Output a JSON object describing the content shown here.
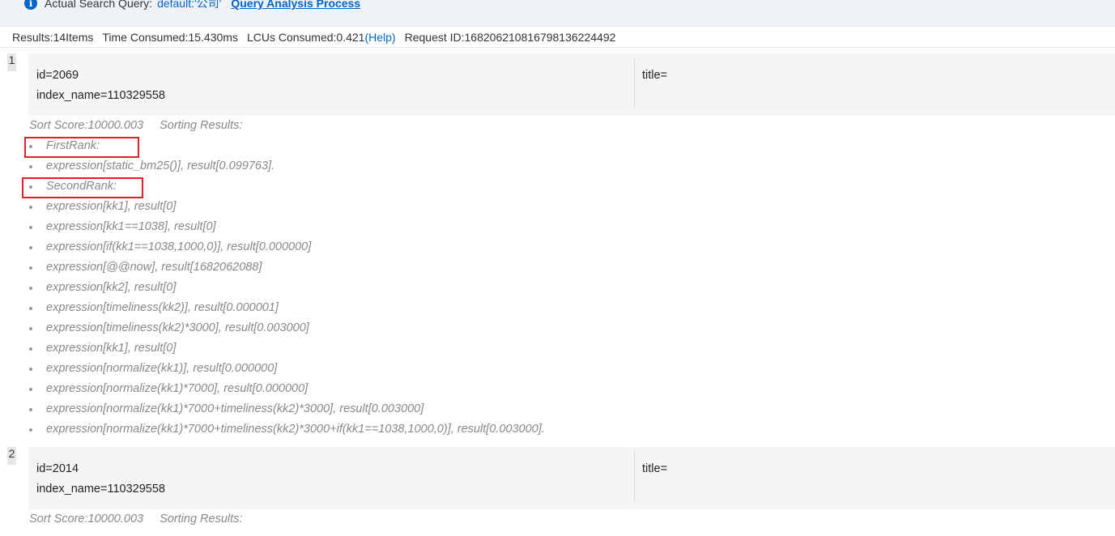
{
  "query": {
    "label": "Actual Search Query:",
    "value": "default:'公司'",
    "link": "Query Analysis Process"
  },
  "stats": {
    "results": "Results:14Items",
    "time": "Time Consumed:15.430ms",
    "lcu": "LCUs Consumed:0.421",
    "help": "(Help)",
    "request": "Request ID:168206210816798136224492"
  },
  "results": [
    {
      "index": "1",
      "id": "id=2069",
      "index_name": "index_name=110329558",
      "title": "title=",
      "sort_score": "Sort Score:10000.003",
      "sorting_results": "Sorting Results:",
      "rank_items": [
        "FirstRank:",
        "expression[static_bm25()], result[0.099763].",
        "SecondRank:",
        "expression[kk1], result[0]",
        "expression[kk1==1038], result[0]",
        "expression[if(kk1==1038,1000,0)], result[0.000000]",
        "expression[@@now], result[1682062088]",
        "expression[kk2], result[0]",
        "expression[timeliness(kk2)], result[0.000001]",
        "expression[timeliness(kk2)*3000], result[0.003000]",
        "expression[kk1], result[0]",
        "expression[normalize(kk1)], result[0.000000]",
        "expression[normalize(kk1)*7000], result[0.000000]",
        "expression[normalize(kk1)*7000+timeliness(kk2)*3000], result[0.003000]",
        "expression[normalize(kk1)*7000+timeliness(kk2)*3000+if(kk1==1038,1000,0)], result[0.003000]."
      ]
    },
    {
      "index": "2",
      "id": "id=2014",
      "index_name": "index_name=110329558",
      "title": "title=",
      "sort_score": "Sort Score:10000.003",
      "sorting_results": "Sorting Results:"
    }
  ],
  "colors": {
    "link": "#0064c8",
    "highlight_box": "#e0202a",
    "card_bg": "#f5f5f5",
    "muted_text": "#888888"
  }
}
